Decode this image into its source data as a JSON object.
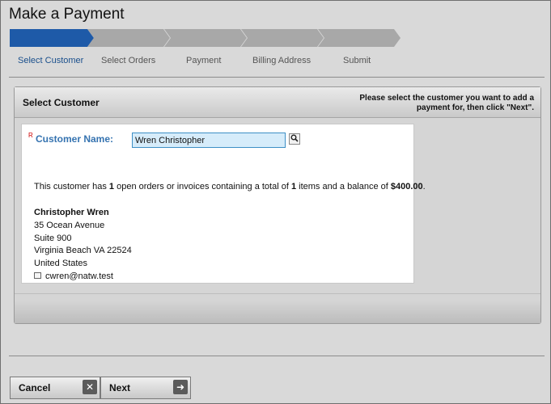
{
  "window": {
    "title": "Make a Payment"
  },
  "wizard": {
    "steps": [
      {
        "label": "Select Customer",
        "active": true
      },
      {
        "label": "Select Orders",
        "active": false
      },
      {
        "label": "Payment",
        "active": false
      },
      {
        "label": "Billing Address",
        "active": false
      },
      {
        "label": "Submit",
        "active": false
      }
    ],
    "active_color": "#1e5aa8",
    "inactive_color": "#a8a8a8"
  },
  "panel": {
    "title": "Select Customer",
    "help_text": "Please select the customer you want to add a payment for, then click \"Next\"."
  },
  "form": {
    "required_marker": "R",
    "customer_label": "Customer Name:",
    "customer_value": "Wren Christopher",
    "search_icon": "magnifier-icon"
  },
  "summary": {
    "prefix": "This customer has ",
    "open_orders": "1",
    "middle1": " open orders or invoices containing a total of ",
    "items": "1",
    "middle2": " items and a balance of ",
    "balance": "$400.00",
    "suffix": "."
  },
  "customer": {
    "name": "Christopher Wren",
    "address1": "35 Ocean Avenue",
    "address2": "Suite 900",
    "city_line": "Virginia Beach VA 22524",
    "country": "United States",
    "email": "cwren@natw.test"
  },
  "buttons": {
    "cancel": "Cancel",
    "next": "Next"
  }
}
